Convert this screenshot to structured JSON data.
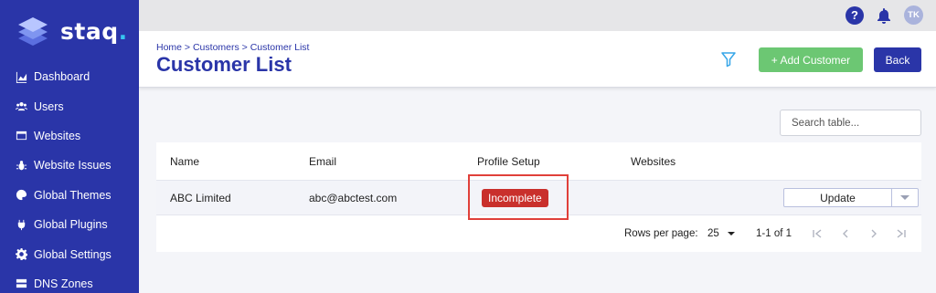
{
  "app": {
    "brand": "staq",
    "brand_dot": "."
  },
  "sidebar": {
    "items": [
      {
        "label": "Dashboard",
        "icon": "chart-icon"
      },
      {
        "label": "Users",
        "icon": "users-icon"
      },
      {
        "label": "Websites",
        "icon": "browser-window-icon"
      },
      {
        "label": "Website Issues",
        "icon": "bug-icon"
      },
      {
        "label": "Global Themes",
        "icon": "palette-icon"
      },
      {
        "label": "Global Plugins",
        "icon": "plug-icon"
      },
      {
        "label": "Global Settings",
        "icon": "gear-icon"
      },
      {
        "label": "DNS Zones",
        "icon": "server-icon"
      }
    ]
  },
  "topbar": {
    "help": "?",
    "avatar_initials": "TK"
  },
  "header": {
    "breadcrumb": "Home > Customers > Customer List",
    "title": "Customer List",
    "add_label": "+ Add Customer",
    "back_label": "Back"
  },
  "search": {
    "placeholder": "Search table..."
  },
  "table": {
    "columns": [
      "Name",
      "Email",
      "Profile Setup",
      "Websites"
    ],
    "rows": [
      {
        "name": "ABC Limited",
        "email": "abc@abctest.com",
        "profile_setup": "Incomplete",
        "websites": "",
        "action": "Update"
      }
    ]
  },
  "pagination": {
    "rows_per_page_label": "Rows per page:",
    "rows_per_page": "25",
    "range": "1-1 of 1"
  },
  "colors": {
    "primary": "#2a35a8",
    "success": "#6cc773",
    "danger": "#c9302c",
    "highlight": "#e0403a"
  }
}
